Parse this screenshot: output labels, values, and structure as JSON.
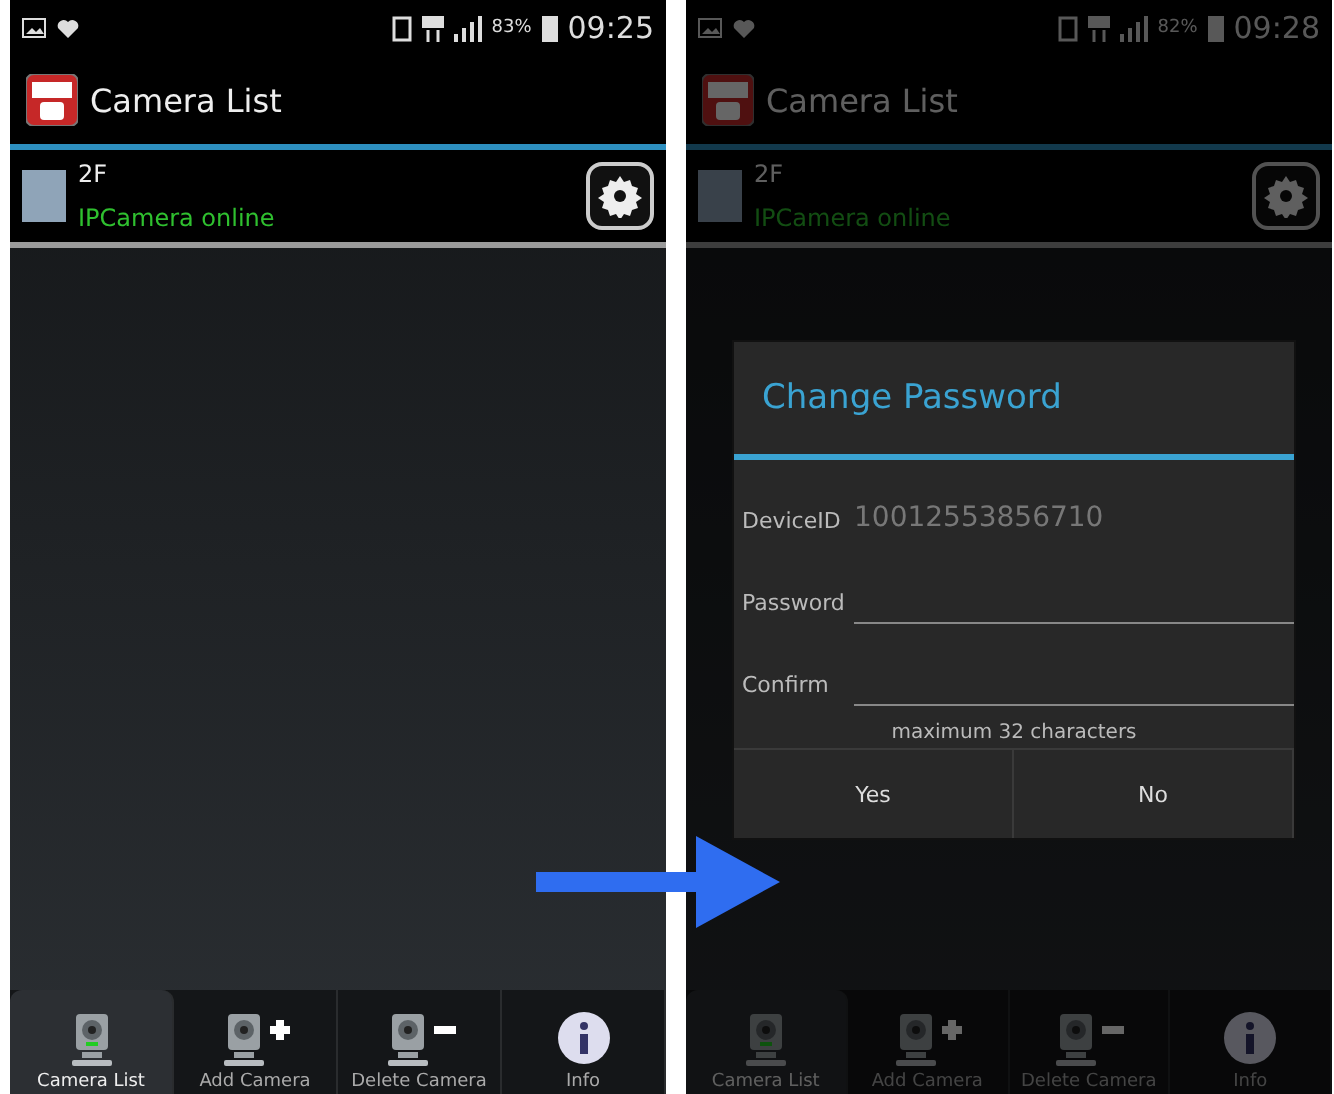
{
  "screens": [
    {
      "status_bar": {
        "battery": "83%",
        "time": "09:25"
      },
      "title": "Camera List",
      "cameras": [
        {
          "name": "2F",
          "status": "IPCamera online"
        }
      ],
      "tabs": [
        {
          "label": "Camera List",
          "kind": "camera",
          "selected": true
        },
        {
          "label": "Add Camera",
          "kind": "add",
          "selected": false
        },
        {
          "label": "Delete Camera",
          "kind": "delete",
          "selected": false
        },
        {
          "label": "Info",
          "kind": "info",
          "selected": false
        }
      ]
    },
    {
      "status_bar": {
        "battery": "82%",
        "time": "09:28"
      },
      "title": "Camera List",
      "cameras": [
        {
          "name": "2F",
          "status": "IPCamera online"
        }
      ],
      "dialog": {
        "title": "Change Password",
        "fields": [
          {
            "label": "DeviceID",
            "kind": "text",
            "value": "10012553856710"
          },
          {
            "label": "Password",
            "kind": "input"
          },
          {
            "label": "Confirm",
            "kind": "input"
          }
        ],
        "hint": "maximum 32 characters",
        "buttons": [
          "Yes",
          "No"
        ]
      },
      "tabs": [
        {
          "label": "Camera List",
          "kind": "camera",
          "selected": true
        },
        {
          "label": "Add Camera",
          "kind": "add",
          "selected": false
        },
        {
          "label": "Delete Camera",
          "kind": "delete",
          "selected": false
        },
        {
          "label": "Info",
          "kind": "info",
          "selected": false
        }
      ]
    }
  ]
}
